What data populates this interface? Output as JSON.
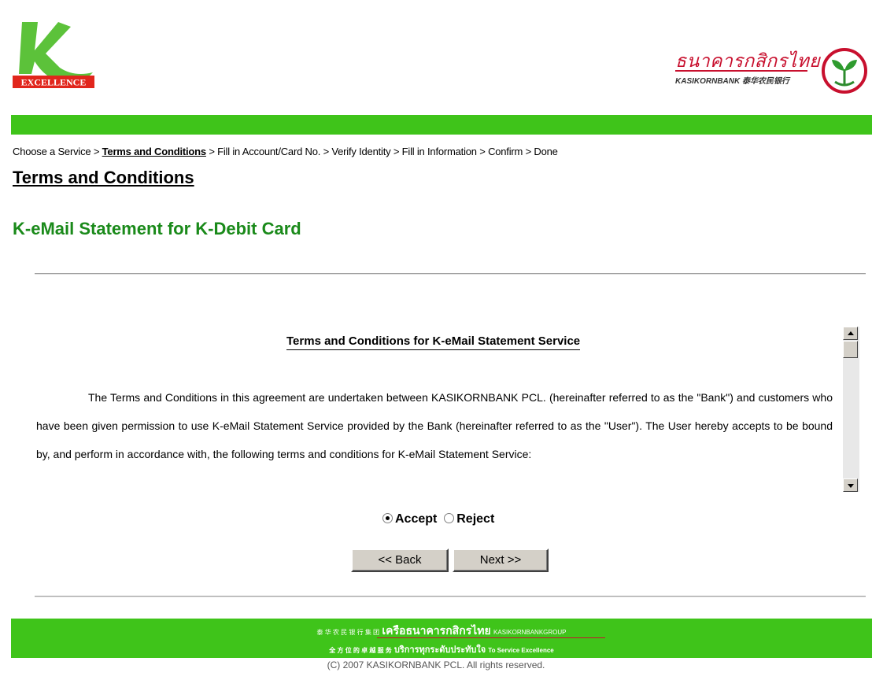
{
  "header": {
    "k_logo_label": "EXCELLENCE",
    "bank_name_thai": "ธนาคารกสิกรไทย",
    "bank_name_en": "KASIKORNBANK 泰华农民银行"
  },
  "breadcrumb": {
    "step1": "Choose a Service",
    "sep": " > ",
    "step2": "Terms and Conditions",
    "step3": "Fill in Account/Card No.",
    "step4": "Verify Identity",
    "step5": "Fill in Information",
    "step6": "Confirm",
    "step7": "Done"
  },
  "page_title": "Terms and Conditions",
  "service_title": "K-eMail Statement for K-Debit Card",
  "terms": {
    "heading": "Terms and Conditions for K-eMail Statement Service",
    "body": "The Terms and Conditions in this agreement are undertaken between KASIKORNBANK PCL. (hereinafter referred to as the \"Bank\") and customers who have been given permission to use K-eMail Statement Service provided by the Bank (hereinafter referred to as the \"User\").  The User hereby accepts to be bound by, and perform in accordance with, the following terms and conditions for K-eMail Statement Service:"
  },
  "choice": {
    "accept_label": "Accept",
    "reject_label": "Reject",
    "selected": "Accept"
  },
  "buttons": {
    "back": "<< Back",
    "next": "Next >>"
  },
  "footer": {
    "group_cn": "泰 华 农 民 银 行 集 团",
    "group_thai": "เครือธนาคารกสิกรไทย",
    "group_en": "KASIKORNBANKGROUP",
    "slogan_cn": "全 方 位 的 卓 越 服 务",
    "slogan_thai": "บริการทุกระดับประทับใจ",
    "slogan_en": "To Service Excellence",
    "copyright": "(C) 2007 KASIKORNBANK PCL. All rights reserved."
  },
  "colors": {
    "brand_green": "#3fc41a",
    "title_green": "#1a8a1a",
    "brand_red": "#c8102e"
  }
}
